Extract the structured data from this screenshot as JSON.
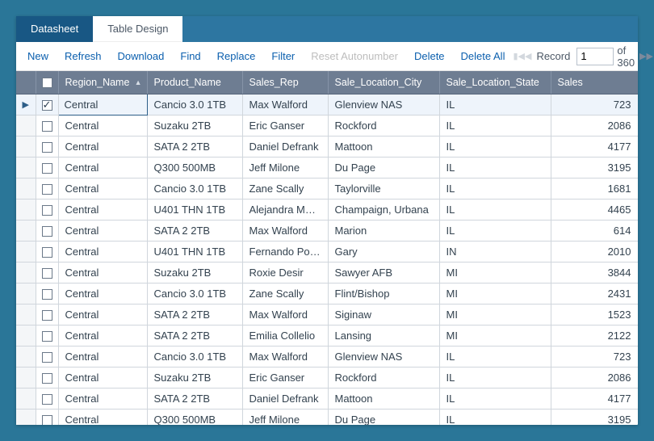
{
  "tabs": {
    "active": "Datasheet",
    "inactive": "Table Design"
  },
  "toolbar": {
    "new": "New",
    "refresh": "Refresh",
    "download": "Download",
    "find": "Find",
    "replace": "Replace",
    "filter": "Filter",
    "reset": "Reset Autonumber",
    "delete": "Delete",
    "deleteAll": "Delete All",
    "recordLabel": "Record",
    "recordValue": "1",
    "ofLabel": "of 360"
  },
  "columns": {
    "region": "Region_Name",
    "product": "Product_Name",
    "rep": "Sales_Rep",
    "city": "Sale_Location_City",
    "state": "Sale_Location_State",
    "sales": "Sales"
  },
  "rows": [
    {
      "sel": true,
      "check": true,
      "region": "Central",
      "product": "Cancio 3.0 1TB",
      "rep": "Max Walford",
      "city": "Glenview NAS",
      "state": "IL",
      "sales": "723"
    },
    {
      "region": "Central",
      "product": "Suzaku 2TB",
      "rep": "Eric Ganser",
      "city": "Rockford",
      "state": "IL",
      "sales": "2086"
    },
    {
      "region": "Central",
      "product": "SATA 2 2TB",
      "rep": "Daniel Defrank",
      "city": "Mattoon",
      "state": "IL",
      "sales": "4177"
    },
    {
      "region": "Central",
      "product": "Q300 500MB",
      "rep": "Jeff Milone",
      "city": "Du Page",
      "state": "IL",
      "sales": "3195"
    },
    {
      "region": "Central",
      "product": "Cancio 3.0 1TB",
      "rep": "Zane Scally",
      "city": "Taylorville",
      "state": "IL",
      "sales": "1681"
    },
    {
      "region": "Central",
      "product": "U401 THN 1TB",
      "rep": "Alejandra Maybee",
      "city": "Champaign, Urbana",
      "state": "IL",
      "sales": "4465"
    },
    {
      "region": "Central",
      "product": "SATA 2 2TB",
      "rep": "Max Walford",
      "city": "Marion",
      "state": "IL",
      "sales": "614"
    },
    {
      "region": "Central",
      "product": "U401 THN 1TB",
      "rep": "Fernando Ponds",
      "city": "Gary",
      "state": "IN",
      "sales": "2010"
    },
    {
      "region": "Central",
      "product": "Suzaku 2TB",
      "rep": "Roxie Desir",
      "city": "Sawyer AFB",
      "state": "MI",
      "sales": "3844"
    },
    {
      "region": "Central",
      "product": "Cancio 3.0 1TB",
      "rep": "Zane Scally",
      "city": "Flint/Bishop",
      "state": "MI",
      "sales": "2431"
    },
    {
      "region": "Central",
      "product": "SATA 2 2TB",
      "rep": "Max Walford",
      "city": "Siginaw",
      "state": "MI",
      "sales": "1523"
    },
    {
      "region": "Central",
      "product": "SATA 2 2TB",
      "rep": "Emilia Collelio",
      "city": "Lansing",
      "state": "MI",
      "sales": "2122"
    },
    {
      "region": "Central",
      "product": "Cancio 3.0 1TB",
      "rep": "Max Walford",
      "city": "Glenview NAS",
      "state": "IL",
      "sales": "723"
    },
    {
      "region": "Central",
      "product": "Suzaku 2TB",
      "rep": "Eric Ganser",
      "city": "Rockford",
      "state": "IL",
      "sales": "2086"
    },
    {
      "region": "Central",
      "product": "SATA 2 2TB",
      "rep": "Daniel Defrank",
      "city": "Mattoon",
      "state": "IL",
      "sales": "4177"
    },
    {
      "region": "Central",
      "product": "Q300 500MB",
      "rep": "Jeff Milone",
      "city": "Du Page",
      "state": "IL",
      "sales": "3195"
    }
  ]
}
